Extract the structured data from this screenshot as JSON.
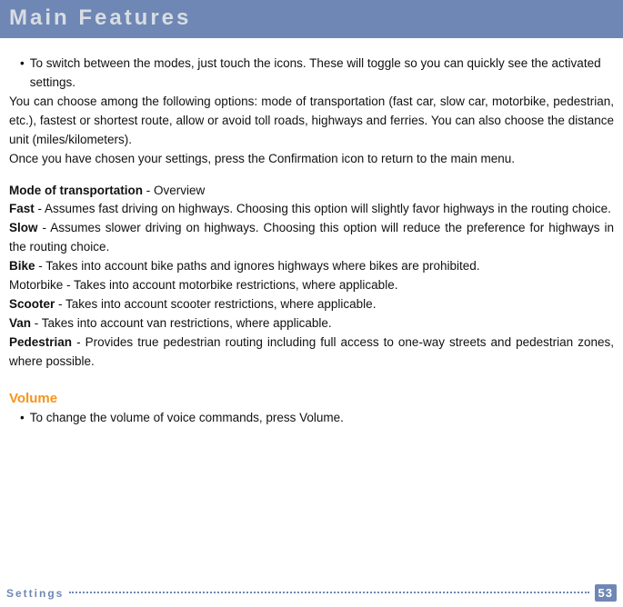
{
  "header": {
    "title": "Main Features"
  },
  "intro": {
    "bullet": "To switch between the modes, just touch the icons. These will toggle so you can quickly see the activated settings.",
    "p1": "You can choose among the following options: mode of transportation (fast car, slow car, motorbike, pedestrian, etc.), fastest or shortest route, allow or avoid toll roads, highways and ferries. You can also choose the distance unit (miles/kilometers).",
    "p2": "Once you have chosen your settings, press the Confirmation icon to return to the main menu."
  },
  "modes": {
    "heading_bold": "Mode of transportation",
    "heading_rest": " - Overview",
    "fast_bold": "Fast",
    "fast_rest": " - Assumes fast driving on highways. Choosing this option will slightly favor highways in the routing choice.",
    "slow_bold": "Slow",
    "slow_rest": " - Assumes slower driving on highways. Choosing this option will reduce the preference for highways in the routing choice.",
    "bike_bold": "Bike",
    "bike_rest": " - Takes into account bike paths and ignores highways where bikes are prohibited.",
    "motorbike": "Motorbike - Takes into account motorbike restrictions, where applicable.",
    "scooter_bold": "Scooter",
    "scooter_rest": " - Takes into account scooter restrictions, where applicable.",
    "van_bold": "Van",
    "van_rest": " - Takes into account van restrictions, where applicable.",
    "ped_bold": "Pedestrian",
    "ped_rest": " - Provides true pedestrian routing including full access to one-way streets and pedestrian zones, where possible."
  },
  "volume": {
    "heading": "Volume",
    "bullet": "To change the volume of voice commands, press Volume."
  },
  "footer": {
    "section": "Settings",
    "page": "53"
  }
}
